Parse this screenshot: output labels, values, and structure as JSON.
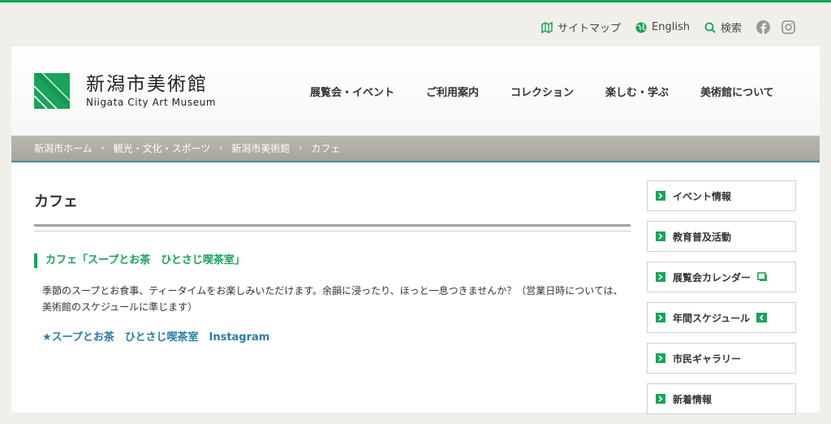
{
  "utility": {
    "sitemap": "サイトマップ",
    "english": "English",
    "search": "検索"
  },
  "logo": {
    "jp": "新潟市美術館",
    "en": "Niigata City Art Museum"
  },
  "gnav": [
    "展覧会・イベント",
    "ご利用案内",
    "コレクション",
    "楽しむ・学ぶ",
    "美術館について"
  ],
  "breadcrumb": [
    "新潟市ホーム",
    "観光・文化・スポーツ",
    "新潟市美術館",
    "カフェ"
  ],
  "main": {
    "title": "カフェ",
    "section_heading": "カフェ「スープとお茶　ひとさじ喫茶室」",
    "body": "季節のスープとお食事、ティータイムをお楽しみいただけます。余韻に浸ったり、ほっと一息つきませんか？（営業日時については、美術館のスケジュールに準じます）",
    "link": "★スープとお茶　ひとさじ喫茶室　Instagram"
  },
  "side": [
    "イベント情報",
    "教育普及活動",
    "展覧会カレンダー",
    "年間スケジュール",
    "市民ギャラリー",
    "新着情報"
  ],
  "colors": {
    "accent_green": "#1aa35a",
    "link_blue": "#2b7da6",
    "breadcrumb_bg": "#aeaba3"
  }
}
